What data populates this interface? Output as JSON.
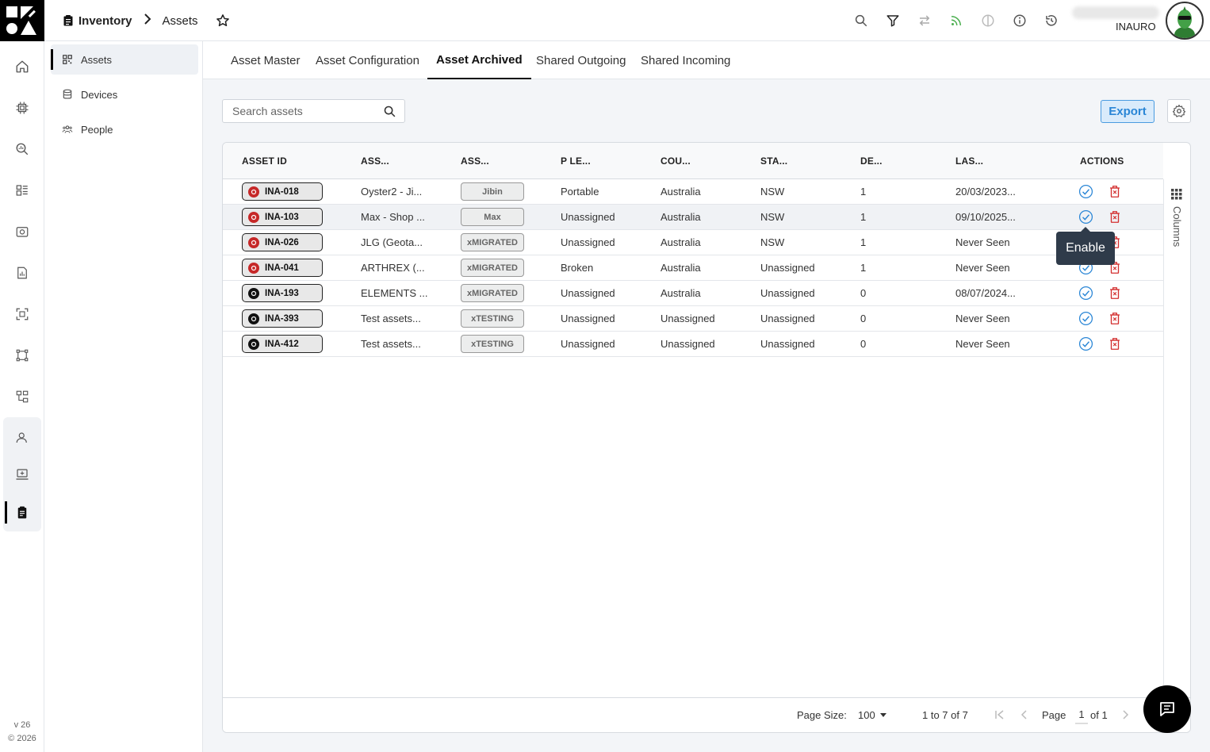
{
  "breadcrumb": {
    "root": "Inventory",
    "current": "Assets"
  },
  "user": {
    "name": "INAURO"
  },
  "sidenav": [
    {
      "label": "Assets",
      "icon": "qr-grid-icon",
      "active": true
    },
    {
      "label": "Devices",
      "icon": "database-icon",
      "active": false
    },
    {
      "label": "People",
      "icon": "people-icon",
      "active": false
    }
  ],
  "tabs": [
    "Asset Master",
    "Asset Configuration",
    "Asset Archived",
    "Shared Outgoing",
    "Shared Incoming"
  ],
  "active_tab": "Asset Archived",
  "search": {
    "placeholder": "Search assets"
  },
  "toolbar": {
    "export_label": "Export"
  },
  "table": {
    "columns": [
      "ASSET ID",
      "ASS...",
      "ASS...",
      "P LE...",
      "COU...",
      "STA...",
      "DE...",
      "LAS...",
      "ACTIONS"
    ],
    "rows": [
      {
        "id": "INA-018",
        "name": "Oyster2 - Ji...",
        "tag": "Jibin",
        "level": "Portable",
        "country": "Australia",
        "state": "NSW",
        "devices": "1",
        "last": "20/03/2023...",
        "dot": "#c62828"
      },
      {
        "id": "INA-103",
        "name": "Max - Shop ...",
        "tag": "Max",
        "level": "Unassigned",
        "country": "Australia",
        "state": "NSW",
        "devices": "1",
        "last": "09/10/2025...",
        "dot": "#c62828"
      },
      {
        "id": "INA-026",
        "name": "JLG (Geota...",
        "tag": "xMIGRATED",
        "level": "Unassigned",
        "country": "Australia",
        "state": "NSW",
        "devices": "1",
        "last": "Never Seen",
        "dot": "#c62828"
      },
      {
        "id": "INA-041",
        "name": "ARTHREX (...",
        "tag": "xMIGRATED",
        "level": "Broken",
        "country": "Australia",
        "state": "Unassigned",
        "devices": "1",
        "last": "Never Seen",
        "dot": "#c62828"
      },
      {
        "id": "INA-193",
        "name": "ELEMENTS ...",
        "tag": "xMIGRATED",
        "level": "Unassigned",
        "country": "Australia",
        "state": "Unassigned",
        "devices": "0",
        "last": "08/07/2024...",
        "dot": "#111111"
      },
      {
        "id": "INA-393",
        "name": "Test assets...",
        "tag": "xTESTING",
        "level": "Unassigned",
        "country": "Unassigned",
        "state": "Unassigned",
        "devices": "0",
        "last": "Never Seen",
        "dot": "#111111"
      },
      {
        "id": "INA-412",
        "name": "Test assets...",
        "tag": "xTESTING",
        "level": "Unassigned",
        "country": "Unassigned",
        "state": "Unassigned",
        "devices": "0",
        "last": "Never Seen",
        "dot": "#111111"
      }
    ]
  },
  "columns_panel": {
    "label": "Columns"
  },
  "tooltip": {
    "text": "Enable"
  },
  "pagination": {
    "page_size_label": "Page Size:",
    "page_size": "100",
    "range": "1 to 7 of 7",
    "page_label": "Page",
    "page": "1",
    "of": "of 1"
  },
  "version": {
    "ver": "v 26",
    "copy": "© 2026"
  },
  "colors": {
    "accent": "#2a86d6",
    "danger": "#d32f2f",
    "tooltip_bg": "#2f3b4a"
  }
}
